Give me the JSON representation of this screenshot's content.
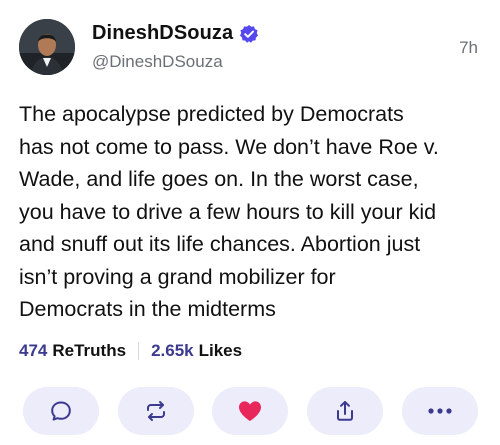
{
  "author": {
    "display_name": "DineshDSouza",
    "handle": "@DineshDSouza",
    "verified": true
  },
  "post": {
    "time_ago": "7h",
    "lines": [
      "The apocalypse predicted by Democrats",
      "has not come to pass. We don’t have Roe v.",
      "Wade, and life goes on. In the worst case,",
      "you have to drive a few hours to kill your kid",
      "and snuff out its life chances. Abortion just",
      "isn’t proving a grand mobilizer for",
      "Democrats in the midterms"
    ]
  },
  "stats": {
    "retruths_count": "474",
    "retruths_label": "ReTruths",
    "likes_count": "2.65k",
    "likes_label": "Likes"
  },
  "actions": [
    {
      "name": "reply",
      "icon": "speech-bubble-icon"
    },
    {
      "name": "retruth",
      "icon": "repost-arrows-icon"
    },
    {
      "name": "like",
      "icon": "heart-icon"
    },
    {
      "name": "share",
      "icon": "share-upload-icon"
    },
    {
      "name": "more",
      "icon": "ellipsis-icon"
    }
  ],
  "colors": {
    "accent": "#5448ee",
    "accent_dark": "#3b3a8f",
    "button_bg": "#ececfa",
    "like_red": "#e8275a",
    "muted_text": "#6b6f76"
  }
}
